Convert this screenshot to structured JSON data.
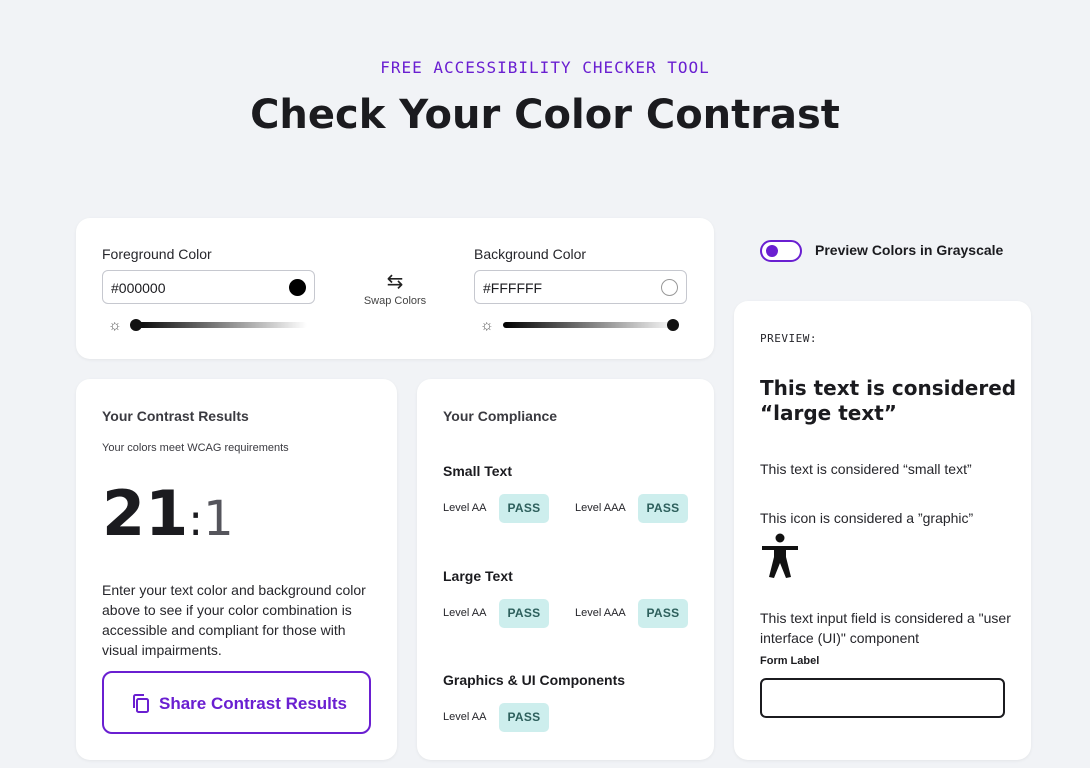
{
  "header": {
    "eyebrow": "FREE ACCESSIBILITY CHECKER TOOL",
    "title": "Check Your Color Contrast"
  },
  "colors": {
    "foreground": {
      "label": "Foreground Color",
      "value": "#000000",
      "swatch": "#000000",
      "lightness": 0.0
    },
    "background": {
      "label": "Background Color",
      "value": "#FFFFFF",
      "swatch": "#FFFFFF",
      "lightness": 1.0
    },
    "swap_label": "Swap Colors",
    "brightness_icon": "sun-icon",
    "swap_icon": "swap-arrows-icon"
  },
  "grayscale_toggle": {
    "label": "Preview Colors in Grayscale",
    "on": true
  },
  "results": {
    "title": "Your Contrast Results",
    "subtitle": "Your colors meet WCAG requirements",
    "ratio_main": "21",
    "ratio_colon": ":",
    "ratio_suffix": "1",
    "description": "Enter your text color and background color above to see if your color combination is accessible and compliant for those with visual impairments.",
    "share_button": "Share Contrast Results",
    "share_icon": "copy-icon"
  },
  "compliance": {
    "title": "Your Compliance",
    "sections": [
      {
        "name": "Small Text",
        "levels": [
          {
            "level": "Level AA",
            "result": "PASS"
          },
          {
            "level": "Level AAA",
            "result": "PASS"
          }
        ]
      },
      {
        "name": "Large Text",
        "levels": [
          {
            "level": "Level AA",
            "result": "PASS"
          },
          {
            "level": "Level AAA",
            "result": "PASS"
          }
        ]
      },
      {
        "name": "Graphics & UI Components",
        "levels": [
          {
            "level": "Level AA",
            "result": "PASS"
          }
        ]
      }
    ]
  },
  "preview": {
    "eyebrow": "PREVIEW:",
    "large_text": "This text is considered “large text”",
    "small_text": "This text is considered “small text”",
    "graphic_text": "This icon is considered a ”graphic”",
    "graphic_icon": "accessibility-person-icon",
    "ui_text": "This text input field is considered a \"user interface (UI)\" component",
    "form_label": "Form Label",
    "form_value": ""
  },
  "theme": {
    "accent": "#6a1fd1",
    "pass_bg": "#cdeeed",
    "pass_text": "#2d5f5c",
    "page_bg": "#f1f3f6"
  }
}
